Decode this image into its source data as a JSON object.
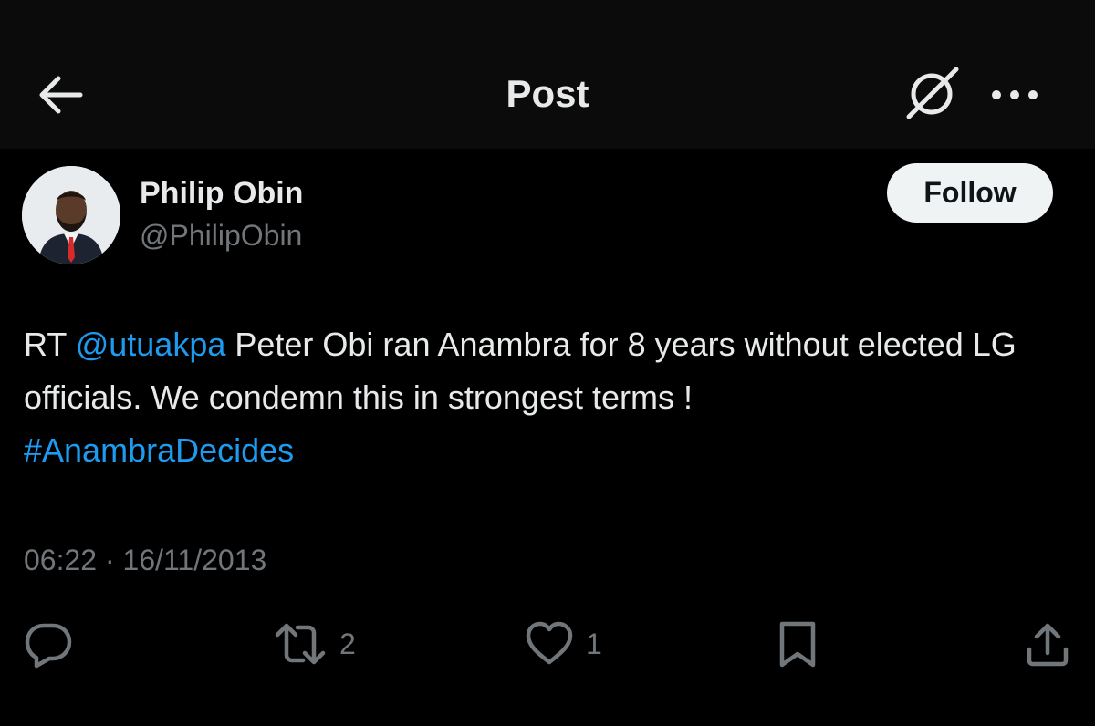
{
  "header": {
    "title": "Post",
    "back_icon": "arrow-left-icon",
    "grok_icon": "grok-icon",
    "more_icon": "more-horizontal-icon"
  },
  "author": {
    "name": "Philip Obin",
    "handle": "@PhilipObin",
    "follow_label": "Follow"
  },
  "post": {
    "prefix": "RT ",
    "mention": "@utuakpa",
    "body": " Peter Obi ran Anambra for 8 years without elected LG officials. We condemn this in strongest terms !",
    "hashtag": "#AnambraDecides",
    "timestamp": "06:22 · 16/11/2013"
  },
  "actions": {
    "reply": {
      "icon": "reply-icon",
      "count": ""
    },
    "repost": {
      "icon": "repost-icon",
      "count": "2"
    },
    "like": {
      "icon": "heart-icon",
      "count": "1"
    },
    "bookmark": {
      "icon": "bookmark-icon",
      "count": ""
    },
    "share": {
      "icon": "share-icon",
      "count": ""
    }
  },
  "colors": {
    "background": "#000000",
    "header_background": "#0b0b0b",
    "text": "#e7e9ea",
    "muted": "#71767b",
    "link": "#1d9bf0",
    "follow_bg": "#eff3f4"
  }
}
